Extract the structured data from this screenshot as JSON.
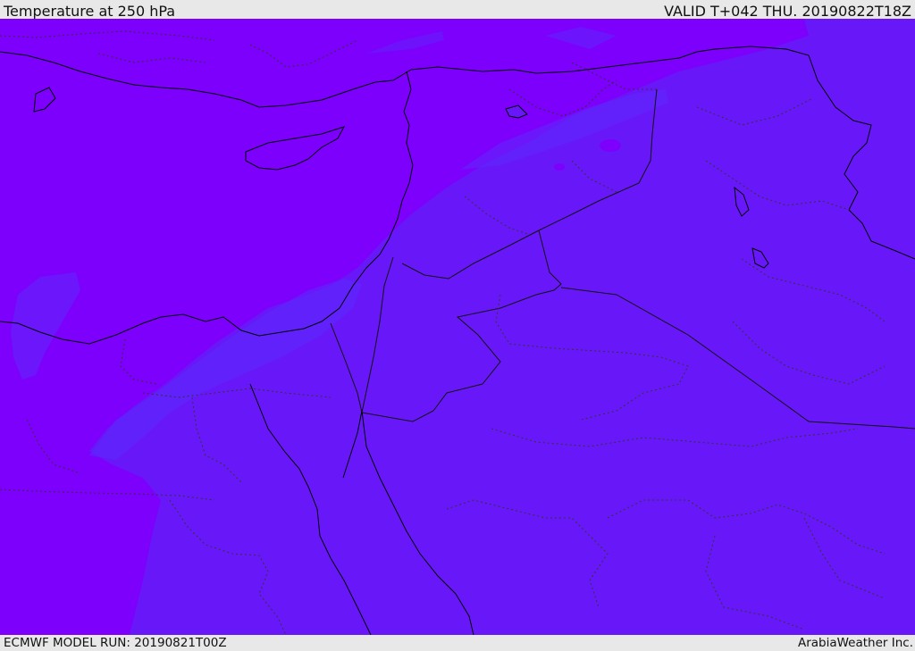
{
  "header": {
    "title": "Temperature at 250 hPa",
    "valid_time": "VALID T+042 THU. 20190822T18Z"
  },
  "footer": {
    "model_run": "ECMWF MODEL RUN: 20190821T00Z",
    "credit": "ArabiaWeather Inc."
  },
  "map": {
    "field_colors": {
      "cold_band": "#7c00fb",
      "mid_band": "#6818f8",
      "transition_band": "#5c28fb"
    },
    "border_colors": {
      "coastline": "#000000",
      "country_border": "#111111",
      "admin_border": "#333333"
    }
  }
}
